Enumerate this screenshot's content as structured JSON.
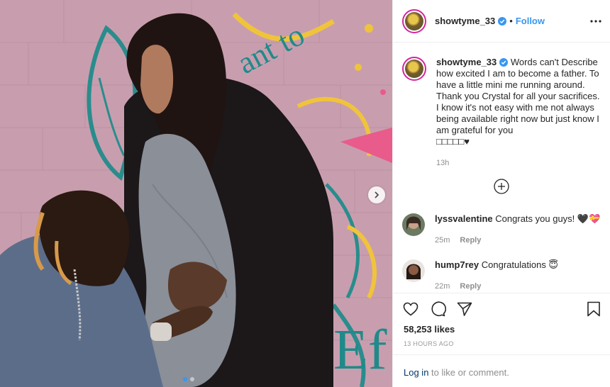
{
  "author": {
    "username": "showtyme_33",
    "verified": true,
    "follow_label": "Follow",
    "bullet": "•"
  },
  "caption": {
    "username": "showtyme_33",
    "text": "Words can't Describe how excited I am to become a father. To have a little mini me running around. Thank you Crystal for all your sacrifices. I know it's not easy with me not always being available right now but just know I am grateful for you",
    "emoji_line": "□□□□□♥",
    "time": "13h"
  },
  "comments": [
    {
      "username": "lyssvalentine",
      "text": "Congrats you guys! 🖤💝",
      "time": "25m",
      "reply_label": "Reply"
    },
    {
      "username": "hump7rey",
      "text": "Congratulations 😇",
      "time": "22m",
      "reply_label": "Reply"
    }
  ],
  "likes_text": "58,253 likes",
  "time_ago": "13 HOURS AGO",
  "login": {
    "link_text": "Log in",
    "rest_text": " to like or comment."
  },
  "icons": {
    "like": "heart-icon",
    "comment": "comment-icon",
    "share": "share-icon",
    "save": "bookmark-icon",
    "more": "more-options-icon",
    "next": "chevron-right-icon",
    "load_more": "plus-circle-icon"
  },
  "carousel": {
    "slides": 2,
    "active": 1
  },
  "colors": {
    "accent": "#3897f0",
    "verified": "#3897f0",
    "text": "#262626",
    "muted": "#8e8e8e"
  }
}
